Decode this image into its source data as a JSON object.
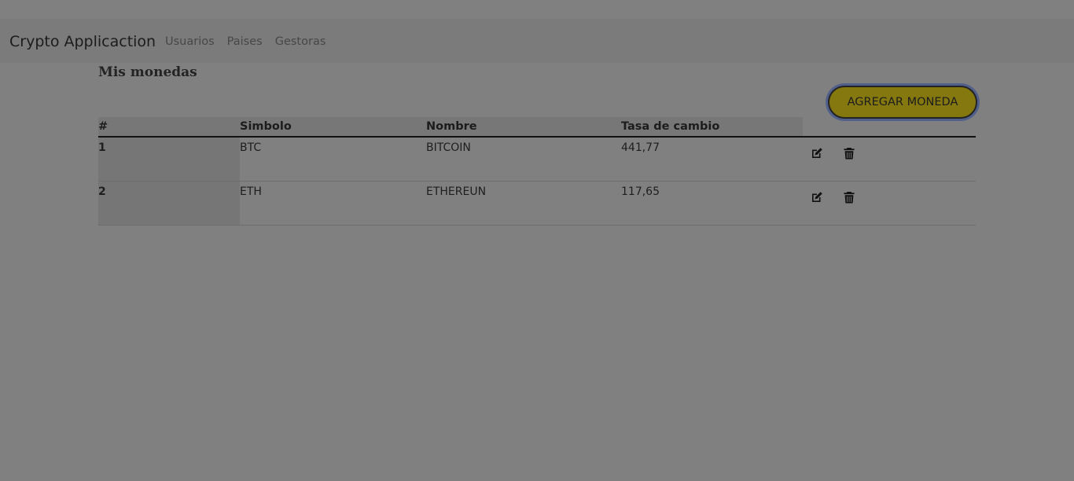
{
  "navbar": {
    "brand": "Crypto Applicaction",
    "links": [
      "Usuarios",
      "Paises",
      "Gestoras"
    ]
  },
  "page": {
    "title": "Mis monedas",
    "add_button_label": "AGREGAR MONEDA"
  },
  "table": {
    "headers": [
      "#",
      "Simbolo",
      "Nombre",
      "Tasa de cambio"
    ],
    "rows": [
      {
        "id": "1",
        "symbol": "BTC",
        "name": "BITCOIN",
        "rate": "441,77",
        "actions": [
          "edit-icon",
          "trash-icon"
        ]
      },
      {
        "id": "2",
        "symbol": "ETH",
        "name": "ETHEREUN",
        "rate": "117,65",
        "actions": [
          "edit-icon",
          "trash-icon"
        ]
      }
    ]
  },
  "colors": {
    "overlay_background": "#808080",
    "add_button_fill": "#85780f",
    "add_button_focus_ring": "#51608a"
  }
}
